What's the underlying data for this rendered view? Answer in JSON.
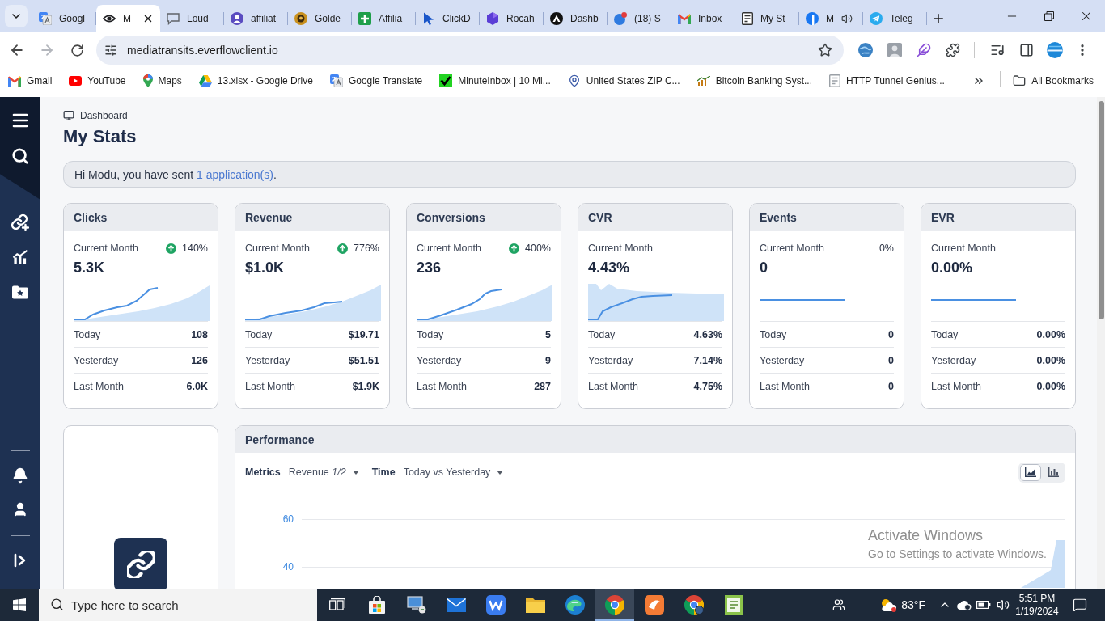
{
  "browser": {
    "tabs": [
      {
        "label": "Googl",
        "selected": false,
        "audible": false
      },
      {
        "label": "M",
        "selected": true,
        "audible": false
      },
      {
        "label": "Loud",
        "selected": false,
        "audible": false
      },
      {
        "label": "affiliat",
        "selected": false,
        "audible": false
      },
      {
        "label": "Golde",
        "selected": false,
        "audible": false
      },
      {
        "label": "Affilia",
        "selected": false,
        "audible": false
      },
      {
        "label": "ClickD",
        "selected": false,
        "audible": false
      },
      {
        "label": "Rocah",
        "selected": false,
        "audible": false
      },
      {
        "label": "Dashb",
        "selected": false,
        "audible": false
      },
      {
        "label": "(18) S",
        "selected": false,
        "audible": false
      },
      {
        "label": "Inbox",
        "selected": false,
        "audible": false
      },
      {
        "label": "My St",
        "selected": false,
        "audible": false
      },
      {
        "label": "M",
        "selected": false,
        "audible": true
      },
      {
        "label": "Teleg",
        "selected": false,
        "audible": false
      }
    ],
    "toolbar": {
      "url": "mediatransits.everflowclient.io",
      "forward_disabled": true
    },
    "bookmarks": [
      {
        "label": "Gmail"
      },
      {
        "label": "YouTube"
      },
      {
        "label": "Maps"
      },
      {
        "label": "13.xlsx - Google Drive"
      },
      {
        "label": "Google Translate"
      },
      {
        "label": "MinuteInbox | 10 Mi..."
      },
      {
        "label": "United States ZIP C..."
      },
      {
        "label": "Bitcoin Banking Syst..."
      },
      {
        "label": "HTTP Tunnel Genius..."
      }
    ],
    "all_bookmarks": "All Bookmarks"
  },
  "page": {
    "breadcrumb": "Dashboard",
    "title": "My Stats",
    "notice": {
      "before": "Hi Modu, you have sent",
      "link": "1 application(s)",
      "after": "."
    },
    "stats": [
      {
        "title": "Clicks",
        "period": "Current Month",
        "change": "140%",
        "trend_up": true,
        "value": "5.3K",
        "kind": "area",
        "rows": [
          {
            "label": "Today",
            "value": "108"
          },
          {
            "label": "Yesterday",
            "value": "126"
          },
          {
            "label": "Last Month",
            "value": "6.0K"
          }
        ]
      },
      {
        "title": "Revenue",
        "period": "Current Month",
        "change": "776%",
        "trend_up": true,
        "value": "$1.0K",
        "kind": "area",
        "rows": [
          {
            "label": "Today",
            "value": "$19.71"
          },
          {
            "label": "Yesterday",
            "value": "$51.51"
          },
          {
            "label": "Last Month",
            "value": "$1.9K"
          }
        ]
      },
      {
        "title": "Conversions",
        "period": "Current Month",
        "change": "400%",
        "trend_up": true,
        "value": "236",
        "kind": "area",
        "rows": [
          {
            "label": "Today",
            "value": "5"
          },
          {
            "label": "Yesterday",
            "value": "9"
          },
          {
            "label": "Last Month",
            "value": "287"
          }
        ]
      },
      {
        "title": "CVR",
        "period": "Current Month",
        "trend_up": false,
        "value": "4.43%",
        "kind": "area",
        "rows": [
          {
            "label": "Today",
            "value": "4.63%"
          },
          {
            "label": "Yesterday",
            "value": "7.14%"
          },
          {
            "label": "Last Month",
            "value": "4.75%"
          }
        ]
      },
      {
        "title": "Events",
        "period": "Current Month",
        "change": "0%",
        "trend_up": false,
        "value": "0",
        "kind": "line",
        "rows": [
          {
            "label": "Today",
            "value": "0"
          },
          {
            "label": "Yesterday",
            "value": "0"
          },
          {
            "label": "Last Month",
            "value": "0"
          }
        ]
      },
      {
        "title": "EVR",
        "period": "Current Month",
        "trend_up": false,
        "value": "0.00%",
        "kind": "line",
        "rows": [
          {
            "label": "Today",
            "value": "0.00%"
          },
          {
            "label": "Yesterday",
            "value": "0.00%"
          },
          {
            "label": "Last Month",
            "value": "0.00%"
          }
        ]
      }
    ],
    "performance": {
      "title": "Performance",
      "metric_label": "Metrics",
      "metric": "Revenue *1/2*",
      "time_label": "Time",
      "time_range": "Today vs Yesterday",
      "views": [
        {
          "kind": "area",
          "selected": true
        },
        {
          "kind": "bar",
          "selected": false
        }
      ],
      "y_tick_labels": [
        "60",
        "40"
      ]
    }
  },
  "windows_activation": {
    "title": "Activate Windows",
    "message": "Go to Settings to activate Windows."
  },
  "taskbar": {
    "search_placeholder": "Type here to search",
    "apps": [
      {
        "selected": false
      },
      {
        "selected": false
      },
      {
        "selected": false
      },
      {
        "selected": false
      },
      {
        "selected": false
      },
      {
        "selected": false
      },
      {
        "selected": true
      },
      {
        "selected": false
      },
      {
        "selected": false
      },
      {
        "selected": false
      }
    ],
    "weather": "83°F",
    "time": "5:51 PM",
    "date": "1/19/2024"
  }
}
